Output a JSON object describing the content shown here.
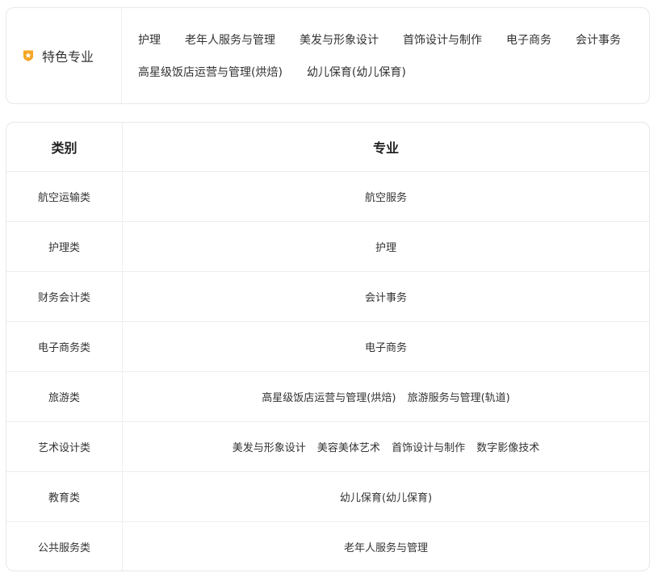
{
  "featured": {
    "label": "特色专业",
    "badge_icon": "star-badge-icon",
    "accent_color": "#f5a623",
    "tags": [
      "护理",
      "老年人服务与管理",
      "美发与形象设计",
      "首饰设计与制作",
      "电子商务",
      "会计事务",
      "高星级饭店运营与管理(烘焙)",
      "幼儿保育(幼儿保育)"
    ]
  },
  "table": {
    "headers": {
      "category": "类别",
      "major": "专业"
    },
    "rows": [
      {
        "category": "航空运输类",
        "majors": [
          "航空服务"
        ]
      },
      {
        "category": "护理类",
        "majors": [
          "护理"
        ]
      },
      {
        "category": "财务会计类",
        "majors": [
          "会计事务"
        ]
      },
      {
        "category": "电子商务类",
        "majors": [
          "电子商务"
        ]
      },
      {
        "category": "旅游类",
        "majors": [
          "高星级饭店运营与管理(烘焙)",
          "旅游服务与管理(轨道)"
        ]
      },
      {
        "category": "艺术设计类",
        "majors": [
          "美发与形象设计",
          "美容美体艺术",
          "首饰设计与制作",
          "数字影像技术"
        ]
      },
      {
        "category": "教育类",
        "majors": [
          "幼儿保育(幼儿保育)"
        ]
      },
      {
        "category": "公共服务类",
        "majors": [
          "老年人服务与管理"
        ]
      }
    ]
  }
}
